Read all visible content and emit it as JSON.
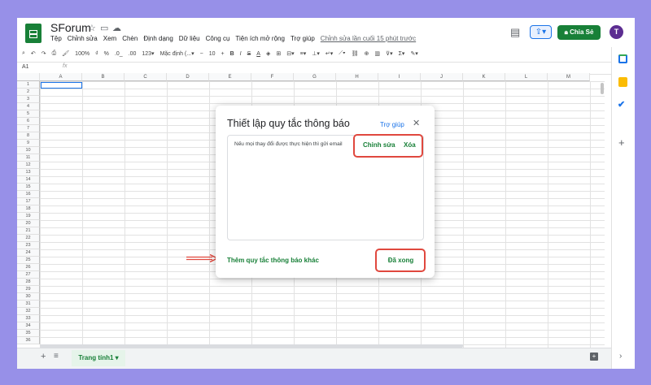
{
  "header": {
    "title": "SForum",
    "menu": [
      "Tệp",
      "Chỉnh sửa",
      "Xem",
      "Chèn",
      "Định dạng",
      "Dữ liệu",
      "Công cụ",
      "Tiện ích mở rộng",
      "Trợ giúp"
    ],
    "last_edit": "Chỉnh sửa lần cuối 15 phút trước",
    "share_label": "Chia Sẻ",
    "avatar_letter": "T"
  },
  "toolbar": {
    "zoom": "100%",
    "currency": "₫",
    "percent": "%",
    "decimal_dec": ".0_",
    "decimal_inc": ".00",
    "more_formats": "123▾",
    "font": "Mặc định (...▾",
    "font_size": "10",
    "bold": "B",
    "italic": "I",
    "strike": "S",
    "text_color": "A"
  },
  "formula_bar": {
    "cell_ref": "A1",
    "fx": "fx"
  },
  "grid": {
    "columns": [
      "A",
      "B",
      "C",
      "D",
      "E",
      "F",
      "G",
      "H",
      "I",
      "J",
      "K",
      "L",
      "M"
    ],
    "rows": [
      "1",
      "2",
      "3",
      "4",
      "5",
      "6",
      "7",
      "8",
      "9",
      "10",
      "11",
      "12",
      "13",
      "14",
      "15",
      "16",
      "17",
      "18",
      "19",
      "20",
      "21",
      "22",
      "23",
      "24",
      "25",
      "26",
      "27",
      "28",
      "29",
      "30",
      "31",
      "32",
      "33",
      "34",
      "35",
      "36"
    ]
  },
  "sheet_tab": {
    "label": "Trang tính1 ▾",
    "add": "+",
    "list": "≡"
  },
  "dialog": {
    "title": "Thiết lập quy tắc thông báo",
    "help": "Trợ giúp",
    "close": "✕",
    "rule_text": "Nếu mọi thay đổi được thực hiện thì gửi email",
    "edit": "Chỉnh sửa",
    "delete": "Xóa",
    "add_rule": "Thêm quy tắc thông báo khác",
    "done": "Đã xong"
  },
  "colors": {
    "background": "#9790e8",
    "green": "#188038",
    "highlight": "#e0483e",
    "link_blue": "#1a73e8"
  }
}
